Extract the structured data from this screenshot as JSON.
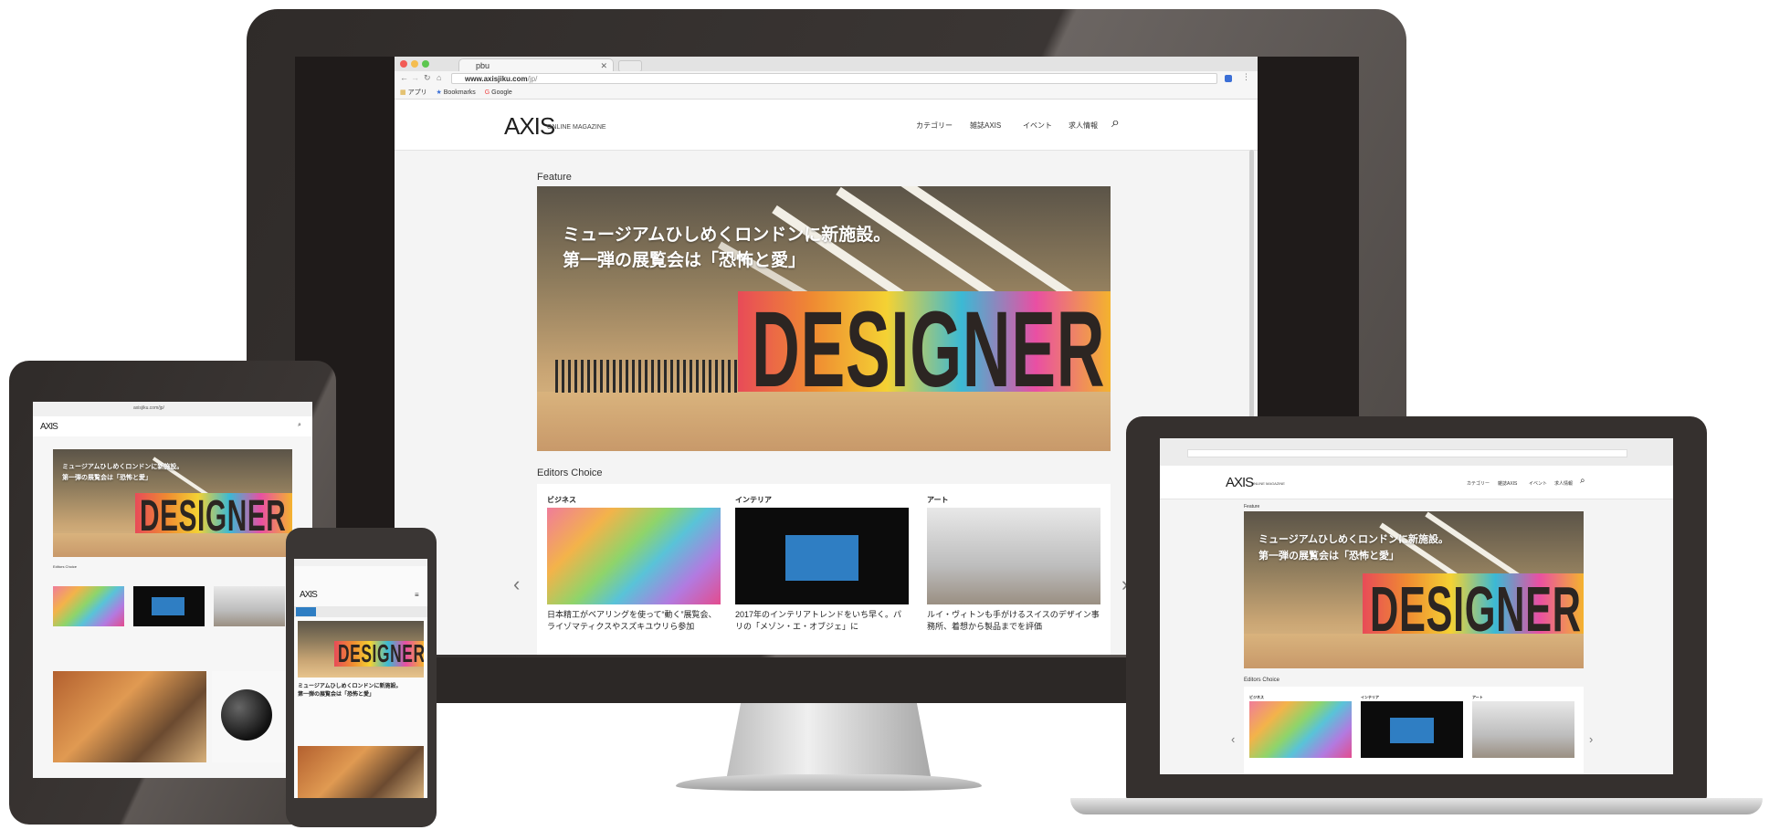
{
  "desktop": {
    "tab_title": "pbu",
    "url": "www.axisjiku.com",
    "url_path": "/jp/",
    "bookmarks": {
      "apps": "アプリ",
      "bookmarks": "Bookmarks",
      "google": "Google"
    },
    "logo": "AXIS",
    "logo_sub": "ONLINE MAGAZINE",
    "nav": [
      "カテゴリー",
      "雑誌AXIS",
      "イベント",
      "求人情報"
    ],
    "feature_label": "Feature",
    "hero_title_line1": "ミュージアムひしめくロンドンに新施設。",
    "hero_title_line2": "第一弾の展覧会は「恐怖と愛」",
    "hero_sign": "DESIGNER",
    "editors_label": "Editors Choice",
    "cards": [
      {
        "category": "ビジネス",
        "title": "日本精工がベアリングを使って“動く”展覧会、ライゾマティクスやスズキユウリら参加"
      },
      {
        "category": "インテリア",
        "title": "2017年のインテリアトレンドをいち早く。パリの「メゾン・エ・オブジェ」に"
      },
      {
        "category": "アート",
        "title": "ルイ・ヴィトンも手がけるスイスのデザイン事務所、着想から製品までを評価"
      }
    ]
  },
  "laptop": {
    "logo": "AXIS",
    "logo_sub": "ONLINE MAGAZINE",
    "nav": [
      "カテゴリー",
      "雑誌AXIS",
      "イベント",
      "求人情報"
    ],
    "feature_label": "Feature",
    "hero_title_line1": "ミュージアムひしめくロンドンに新施設。",
    "hero_title_line2": "第一弾の展覧会は「恐怖と愛」",
    "hero_sign": "DESIGNER",
    "editors_label": "Editors Choice",
    "cats": [
      "ビジネス",
      "インテリア",
      "アート"
    ]
  },
  "tablet": {
    "url": "axisjiku.com/jp/",
    "logo": "AXIS",
    "hero_title_line1": "ミュージアムひしめくロンドンに新施設。",
    "hero_title_line2": "第一弾の展覧会は「恐怖と愛」",
    "hero_sign": "DESIGNER",
    "editors_label": "Editors Choice"
  },
  "phone": {
    "logo": "AXIS",
    "hero_sign": "DESIGNER",
    "caption_line1": "ミュージアムひしめくロンドンに新施設。",
    "caption_line2": "第一弾の展覧会は「恐怖と愛」"
  },
  "colors": {
    "bezel": "#3a3634",
    "accent": "#2f7ec3"
  }
}
